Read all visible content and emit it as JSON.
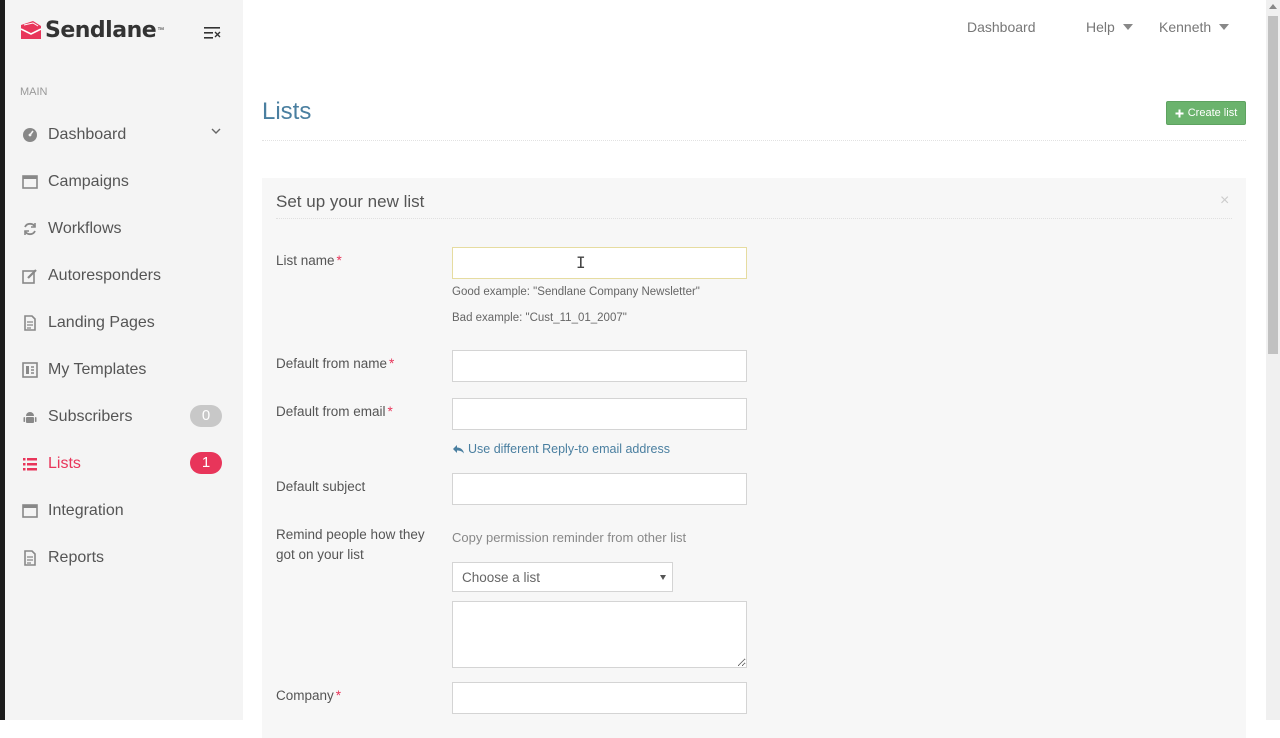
{
  "app": {
    "name": "Sendlane",
    "tm": "™"
  },
  "sidebar": {
    "section_label": "MAIN",
    "items": [
      {
        "label": "Dashboard",
        "icon": "dashboard-icon"
      },
      {
        "label": "Campaigns",
        "icon": "window-icon"
      },
      {
        "label": "Workflows",
        "icon": "refresh-icon"
      },
      {
        "label": "Autoresponders",
        "icon": "edit-icon"
      },
      {
        "label": "Landing Pages",
        "icon": "page-icon"
      },
      {
        "label": "My Templates",
        "icon": "template-icon"
      },
      {
        "label": "Subscribers",
        "icon": "android-icon",
        "badge": "0"
      },
      {
        "label": "Lists",
        "icon": "list-icon",
        "badge": "1",
        "active": true
      },
      {
        "label": "Integration",
        "icon": "window-icon"
      },
      {
        "label": "Reports",
        "icon": "page-icon"
      }
    ]
  },
  "topnav": {
    "dashboard": "Dashboard",
    "help": "Help",
    "user": "Kenneth"
  },
  "page": {
    "title": "Lists",
    "create_button": "Create list"
  },
  "panel": {
    "title": "Set up your new list",
    "close": "×",
    "list_name_label": "List name",
    "good_example": "Good example: \"Sendlane Company Newsletter\"",
    "bad_example": "Bad example: \"Cust_11_01_2007\"",
    "from_name_label": "Default from name",
    "from_email_label": "Default from email",
    "reply_to_link": "Use different Reply-to email address",
    "subject_label": "Default subject",
    "remind_label": "Remind people how they got on your list",
    "copy_permission": "Copy permission reminder from other list",
    "choose_list": "Choose a list",
    "company_label": "Company",
    "required_mark": "*"
  },
  "colors": {
    "accent": "#e8355a",
    "title_blue": "#4a7fa0",
    "button_green": "#6bb36d"
  }
}
